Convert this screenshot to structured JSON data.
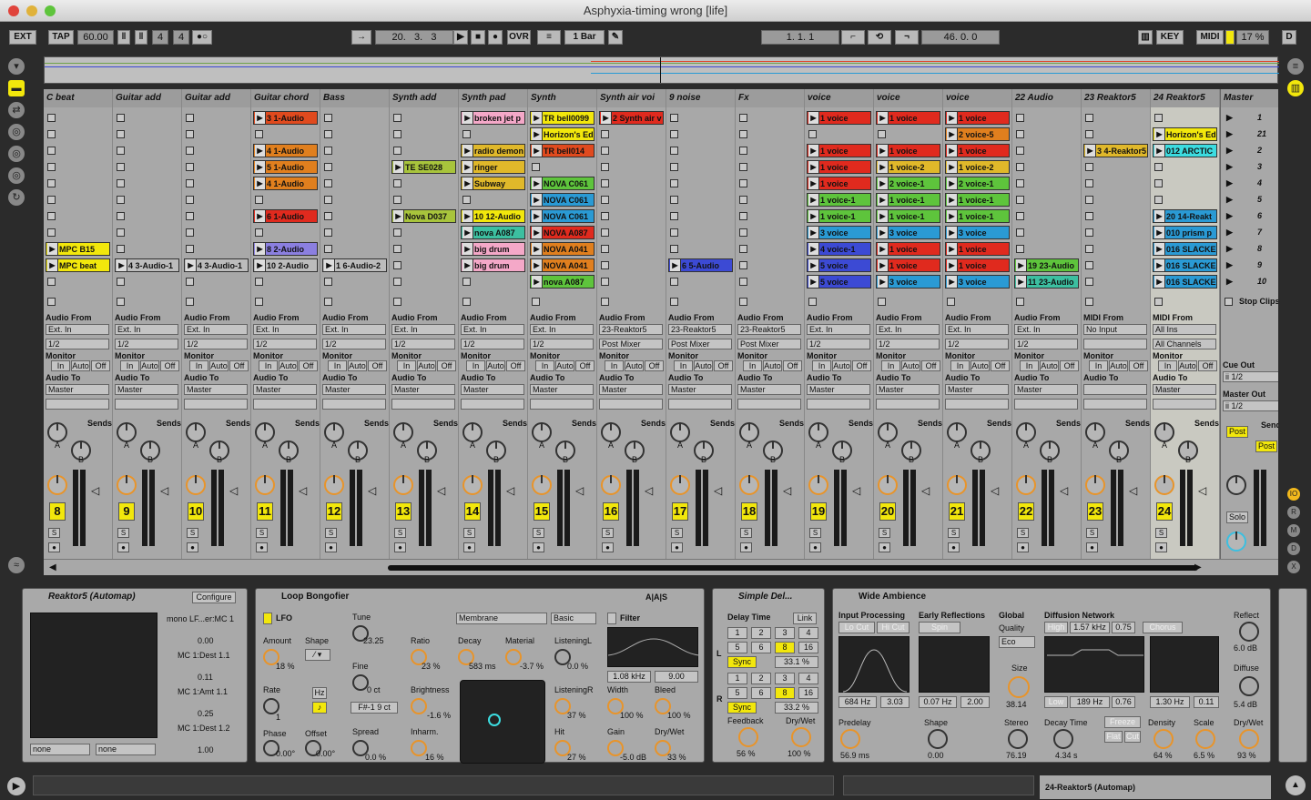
{
  "window": {
    "title": "Asphyxia-timing wrong  [life]"
  },
  "transport": {
    "ext": "EXT",
    "tap": "TAP",
    "tempo": "60.00",
    "sig_num": "4",
    "sig_den": "4",
    "pos1": "20.",
    "pos2": "3.",
    "pos3": "3",
    "ovr": "OVR",
    "quant": "1 Bar",
    "loop_start": "1.   1.   1",
    "loop_len": "46.   0.   0",
    "key": "KEY",
    "midi": "MIDI",
    "cpu": "17 %",
    "d": "D"
  },
  "tracks": [
    {
      "name": "C beat",
      "num": "8",
      "clips": [
        "",
        "",
        "",
        "",
        "",
        "",
        "",
        "",
        "MPC B15",
        "MPC beat"
      ],
      "colors": [
        "",
        "",
        "",
        "",
        "",
        "",
        "",
        "",
        "#f2e70c",
        "#f2e70c"
      ],
      "from": "Ext. In",
      "from2": "1/2",
      "to": "Master",
      "fromlabel": "Audio From"
    },
    {
      "name": "Guitar add",
      "num": "9",
      "clips": [
        "",
        "",
        "",
        "",
        "",
        "",
        "",
        "",
        "",
        "4 3-Audio-1"
      ],
      "colors": [
        "",
        "",
        "",
        "",
        "",
        "",
        "",
        "",
        "",
        "#bcbcbc"
      ],
      "from": "Ext. In",
      "from2": "1/2",
      "to": "Master",
      "fromlabel": "Audio From"
    },
    {
      "name": "Guitar add",
      "num": "10",
      "clips": [
        "",
        "",
        "",
        "",
        "",
        "",
        "",
        "",
        "",
        "4 3-Audio-1"
      ],
      "colors": [
        "",
        "",
        "",
        "",
        "",
        "",
        "",
        "",
        "",
        "#bcbcbc"
      ],
      "from": "Ext. In",
      "from2": "1/2",
      "to": "Master",
      "fromlabel": "Audio From"
    },
    {
      "name": "Guitar chord",
      "num": "11",
      "clips": [
        "3 1-Audio",
        "",
        "4 1-Audio",
        "5 1-Audio",
        "4 1-Audio",
        "",
        "6 1-Audio",
        "",
        "8 2-Audio",
        "10 2-Audio"
      ],
      "colors": [
        "#e04a1e",
        "",
        "#e07f1e",
        "#e07f1e",
        "#e07f1e",
        "",
        "#e02a1e",
        "",
        "#8b7fe0",
        "#bcbcbc"
      ],
      "from": "Ext. In",
      "from2": "1/2",
      "to": "Master",
      "fromlabel": "Audio From"
    },
    {
      "name": "Bass",
      "num": "12",
      "clips": [
        "",
        "",
        "",
        "",
        "",
        "",
        "",
        "",
        "",
        "1 6-Audio-2"
      ],
      "colors": [
        "",
        "",
        "",
        "",
        "",
        "",
        "",
        "",
        "",
        "#bcbcbc"
      ],
      "from": "Ext. In",
      "from2": "1/2",
      "to": "Master",
      "fromlabel": "Audio From"
    },
    {
      "name": "Synth add",
      "num": "13",
      "clips": [
        "",
        "",
        "",
        "TE SE028",
        "",
        "",
        "Nova D037",
        "",
        "",
        ""
      ],
      "colors": [
        "",
        "",
        "",
        "#a8c43c",
        "",
        "",
        "#a8c43c",
        "",
        "",
        ""
      ],
      "from": "Ext. In",
      "from2": "1/2",
      "to": "Master",
      "fromlabel": "Audio From"
    },
    {
      "name": "Synth pad",
      "num": "14",
      "clips": [
        "broken jet p",
        "",
        "radio demon",
        "ringer",
        "Subway",
        "",
        "10 12-Audio",
        "nova A087",
        "big drum",
        "big drum"
      ],
      "colors": [
        "#f4a8c8",
        "",
        "#e0b82a",
        "#e0b82a",
        "#e0b82a",
        "",
        "#f2e70c",
        "#3cbfa0",
        "#f4a8c8",
        "#f4a8c8"
      ],
      "from": "Ext. In",
      "from2": "1/2",
      "to": "Master",
      "fromlabel": "Audio From"
    },
    {
      "name": "Synth",
      "num": "15",
      "clips": [
        "TR bell0099",
        "Horizon's Ed",
        "TR bell014",
        "",
        "NOVA C061",
        "NOVA C061",
        "NOVA C061",
        "NOVA A087",
        "NOVA A041",
        "NOVA A041",
        "nova A087"
      ],
      "colors": [
        "#f2e70c",
        "#f2e70c",
        "#e04a1e",
        "",
        "#5ec43c",
        "#2a9ad4",
        "#2a9ad4",
        "#e02a1e",
        "#e07f1e",
        "#e07f1e",
        "#5ec43c"
      ],
      "from": "Ext. In",
      "from2": "1/2",
      "to": "Master",
      "fromlabel": "Audio From"
    },
    {
      "name": "Synth air voi",
      "num": "16",
      "clips": [
        "2 Synth air v",
        "",
        "",
        "",
        "",
        "",
        "",
        "",
        "",
        ""
      ],
      "colors": [
        "#e02a1e",
        "",
        "",
        "",
        "",
        "",
        "",
        "",
        "",
        ""
      ],
      "from": "23-Reaktor5",
      "from2": "Post Mixer",
      "to": "Master",
      "fromlabel": "Audio From"
    },
    {
      "name": "9 noise",
      "num": "17",
      "clips": [
        "",
        "",
        "",
        "",
        "",
        "",
        "",
        "",
        "",
        "6 5-Audio"
      ],
      "colors": [
        "",
        "",
        "",
        "",
        "",
        "",
        "",
        "",
        "",
        "#3c4ad4"
      ],
      "from": "23-Reaktor5",
      "from2": "Post Mixer",
      "to": "Master",
      "fromlabel": "Audio From"
    },
    {
      "name": "Fx",
      "num": "18",
      "clips": [
        "",
        "",
        "",
        "",
        "",
        "",
        "",
        "",
        "",
        ""
      ],
      "colors": [
        "",
        "",
        "",
        "",
        "",
        "",
        "",
        "",
        "",
        ""
      ],
      "from": "23-Reaktor5",
      "from2": "Post Mixer",
      "to": "Master",
      "fromlabel": "Audio From"
    },
    {
      "name": "voice",
      "num": "19",
      "clips": [
        "1 voice",
        "",
        "1 voice",
        "1 voice",
        "1 voice",
        "1 voice-1",
        "1 voice-1",
        "3 voice",
        "4 voice-1",
        "5 voice",
        "5 voice"
      ],
      "colors": [
        "#e02a1e",
        "",
        "#e02a1e",
        "#e02a1e",
        "#e02a1e",
        "#5ec43c",
        "#5ec43c",
        "#2a9ad4",
        "#3c4ad4",
        "#3c4ad4",
        "#3c4ad4"
      ],
      "from": "Ext. In",
      "from2": "1/2",
      "to": "Master",
      "fromlabel": "Audio From"
    },
    {
      "name": "voice",
      "num": "20",
      "clips": [
        "1 voice",
        "",
        "1 voice",
        "1 voice-2",
        "2 voice-1",
        "1 voice-1",
        "1 voice-1",
        "3 voice",
        "1 voice",
        "1 voice",
        "3 voice"
      ],
      "colors": [
        "#e02a1e",
        "",
        "#e02a1e",
        "#e0b82a",
        "#5ec43c",
        "#5ec43c",
        "#5ec43c",
        "#2a9ad4",
        "#e02a1e",
        "#e02a1e",
        "#2a9ad4"
      ],
      "from": "Ext. In",
      "from2": "1/2",
      "to": "Master",
      "fromlabel": "Audio From"
    },
    {
      "name": "voice",
      "num": "21",
      "clips": [
        "1 voice",
        "2 voice-5",
        "1 voice",
        "1 voice-2",
        "2 voice-1",
        "1 voice-1",
        "1 voice-1",
        "3 voice",
        "1 voice",
        "1 voice",
        "3 voice"
      ],
      "colors": [
        "#e02a1e",
        "#e07f1e",
        "#e02a1e",
        "#e0b82a",
        "#5ec43c",
        "#5ec43c",
        "#5ec43c",
        "#2a9ad4",
        "#e02a1e",
        "#e02a1e",
        "#2a9ad4"
      ],
      "from": "Ext. In",
      "from2": "1/2",
      "to": "Master",
      "fromlabel": "Audio From"
    },
    {
      "name": "22 Audio",
      "num": "22",
      "clips": [
        "",
        "",
        "",
        "",
        "",
        "",
        "",
        "",
        "",
        "19 23-Audio",
        "11 23-Audio"
      ],
      "colors": [
        "",
        "",
        "",
        "",
        "",
        "",
        "",
        "",
        "",
        "#5ec43c",
        "#3cbfa0"
      ],
      "from": "Ext. In",
      "from2": "1/2",
      "to": "Master",
      "fromlabel": "Audio From"
    },
    {
      "name": "23 Reaktor5",
      "num": "23",
      "clips": [
        "",
        "",
        "3 4-Reaktor5",
        "",
        "",
        "",
        "",
        "",
        "",
        ""
      ],
      "colors": [
        "",
        "",
        "#e0b82a",
        "",
        "",
        "",
        "",
        "",
        "",
        ""
      ],
      "from": "No Input",
      "from2": "",
      "to": "",
      "fromlabel": "MIDI From"
    },
    {
      "name": "24 Reaktor5",
      "num": "24",
      "clips": [
        "",
        "Horizon's Ed",
        "012 ARCTIC",
        "",
        "",
        "",
        "20 14-Reakt",
        "010 prism p",
        "016 SLACKE",
        "016 SLACKE",
        "016 SLACKE"
      ],
      "colors": [
        "",
        "#f2e70c",
        "#3cdce0",
        "",
        "",
        "",
        "#2a9ad4",
        "#2a9ad4",
        "#2a9ad4",
        "#2a9ad4",
        "#2a9ad4"
      ],
      "from": "All Ins",
      "from2": "All Channels",
      "to": "Master",
      "fromlabel": "MIDI From"
    }
  ],
  "labels": {
    "monitor": "Monitor",
    "audio_to": "Audio To",
    "in": "In",
    "auto": "Auto",
    "off": "Off",
    "sends": "Sends",
    "a": "A",
    "b": "B",
    "s": "S"
  },
  "master": {
    "name": "Master",
    "scenes": [
      "1",
      "21",
      "2",
      "3",
      "4",
      "5",
      "6",
      "7",
      "8",
      "9",
      "10"
    ],
    "stop": "Stop Clips",
    "cue_out": "Cue Out",
    "cue_val": "ii 1/2",
    "master_out": "Master Out",
    "master_val": "ii 1/2",
    "post": "Post",
    "solo": "Solo"
  },
  "devices": {
    "reaktor": {
      "title": "Reaktor5 (Automap)",
      "configure": "Configure",
      "params": [
        "mono LF...er:MC 1",
        "0.00",
        "MC 1:Dest 1.1",
        "0.11",
        "MC 1:Amt 1.1",
        "0.25",
        "MC 1:Dest 1.2",
        "1.00"
      ],
      "none1": "none",
      "none2": "none"
    },
    "bongo": {
      "title": "Loop Bongofier",
      "lfo": "LFO",
      "amount_l": "Amount",
      "amount_v": "18 %",
      "shape_l": "Shape",
      "rate_l": "Rate",
      "rate_v": "1",
      "hz": "Hz",
      "phase_l": "Phase",
      "phase_v": "0.00°",
      "offset_l": "Offset",
      "offset_v": "0.00°",
      "tune_l": "Tune",
      "tune_v": "23.25",
      "fine_l": "Fine",
      "fine_v": "0 ct",
      "note_v": "F#-1  9  ct",
      "spread_l": "Spread",
      "spread_v": "0.0 %",
      "membrane": "Membrane",
      "basic": "Basic",
      "ratio_l": "Ratio",
      "ratio_v": "23 %",
      "decay_l": "Decay",
      "decay_v": "583 ms",
      "material_l": "Material",
      "material_v": "-3.7 %",
      "brightness_l": "Brightness",
      "brightness_v": "-1.6 %",
      "inharm_l": "Inharm.",
      "inharm_v": "16 %",
      "listenl_l": "ListeningL",
      "listenl_v": "0.0 %",
      "listenr_l": "ListeningR",
      "listenr_v": "37 %",
      "hit_l": "Hit",
      "hit_v": "27 %",
      "filter": "Filter",
      "f1": "1.08 kHz",
      "f2": "9.00",
      "width_l": "Width",
      "width_v": "100 %",
      "bleed_l": "Bleed",
      "bleed_v": "100 %",
      "gain_l": "Gain",
      "gain_v": "-5.0 dB",
      "drywet_l": "Dry/Wet",
      "drywet_v": "33 %",
      "aas": "A|A|S"
    },
    "delay": {
      "title": "Simple Del...",
      "delay_time": "Delay Time",
      "link": "Link",
      "row": [
        "1",
        "2",
        "3",
        "4",
        "5",
        "6",
        "8",
        "16"
      ],
      "sync": "Sync",
      "l_val": "33.1 %",
      "r_val": "33.2 %",
      "feedback_l": "Feedback",
      "feedback_v": "56 %",
      "drywet_l": "Dry/Wet",
      "drywet_v": "100 %",
      "l": "L",
      "r": "R"
    },
    "amb": {
      "title": "Wide Ambience",
      "input_proc": "Input Processing",
      "locut": "Lo Cut",
      "hicut": "Hi Cut",
      "early": "Early Reflections",
      "spin": "Spin",
      "global": "Global",
      "quality": "Quality",
      "eco": "Eco",
      "diff": "Diffusion Network",
      "high": "High",
      "khz": "1.57 kHz",
      "d075": "0.75",
      "chorus": "Chorus",
      "reflect_l": "Reflect",
      "reflect_v": "6.0 dB",
      "hz684": "684 Hz",
      "v303": "3.03",
      "v007": "0.07 Hz",
      "v200": "2.00",
      "size_l": "Size",
      "size_v": "38.14",
      "low": "Low",
      "hz189": "189 Hz",
      "v076": "0.76",
      "khz130": "1.30 Hz",
      "v011": "0.11",
      "diffuse_l": "Diffuse",
      "diffuse_v": "5.4 dB",
      "predelay_l": "Predelay",
      "predelay_v": "56.9 ms",
      "shape_l": "Shape",
      "shape_v": "0.00",
      "stereo_l": "Stereo",
      "stereo_v": "76.19",
      "decay_l": "Decay Time",
      "decay_v": "4.34 s",
      "freeze": "Freeze",
      "flat": "Flat",
      "cut": "Cut",
      "density_l": "Density",
      "density_v": "64 %",
      "scale_l": "Scale",
      "scale_v": "6.5 %",
      "dw_l": "Dry/Wet",
      "dw_v": "93 %"
    }
  },
  "status": {
    "track_name": "24-Reaktor5 (Automap)"
  }
}
